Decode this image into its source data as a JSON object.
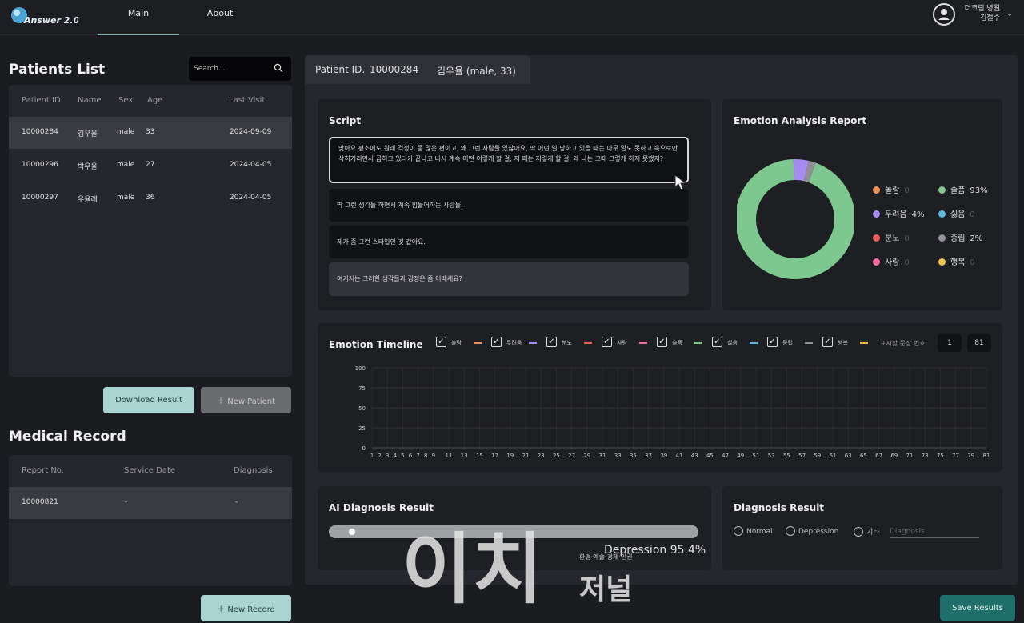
{
  "app": {
    "logo_text": "Answer 2.0"
  },
  "nav": {
    "main": "Main",
    "about": "About"
  },
  "user": {
    "line1": "더크림 병원",
    "line2": "김철수"
  },
  "patients": {
    "title": "Patients List",
    "search_placeholder": "Search...",
    "columns": [
      "Patient ID.",
      "Name",
      "Sex",
      "Age",
      "Last Visit"
    ],
    "rows": [
      {
        "id": "10000284",
        "name": "김우율",
        "sex": "male",
        "age": "33",
        "last": "2024-09-09"
      },
      {
        "id": "10000296",
        "name": "박우율",
        "sex": "male",
        "age": "27",
        "last": "2024-04-05"
      },
      {
        "id": "10000297",
        "name": "우율례",
        "sex": "male",
        "age": "36",
        "last": "2024-04-05"
      }
    ],
    "download": "Download Result",
    "new_patient": "New Patient"
  },
  "medical": {
    "title": "Medical Record",
    "columns": [
      "Report No.",
      "Service Date",
      "Diagnosis"
    ],
    "rows": [
      {
        "no": "10000821",
        "date": "-",
        "diag": "-"
      }
    ],
    "new_record": "New Record"
  },
  "tab": {
    "label": "Patient ID.",
    "id": "10000284",
    "name": "김우율 (male, 33)"
  },
  "script": {
    "title": "Script",
    "utterances": [
      "맞아요 평소에도 원래 걱정이 좀 많은 편이고, 왜 그런 사람들 있잖아요, 딱 어떤 일 당하고 있을 때는 아무 말도 못하고 속으로만 삭히거리면서 곱히고 있다가 끝나고 나서 계속 어떤 이렇게 할 걸, 저 때는 저렇게 할 걸, 왜 나는 그때 그렇게 하지 못했지?",
      "딱 그런 생각들 하면서 계속 힘들어하는 사람들.",
      "제가 좀 그런 스타일인 것 같아요.",
      "여기서는 그러한 생각들과 감정은 좀 어때세요?"
    ]
  },
  "emotion": {
    "title": "Emotion Analysis Report",
    "items": [
      {
        "label": "놀람",
        "pct": "0",
        "color": "#f0935a"
      },
      {
        "label": "슬픔",
        "pct": "93%",
        "color": "#7cc88f"
      },
      {
        "label": "두려움",
        "pct": "4%",
        "color": "#a68bf0"
      },
      {
        "label": "싫음",
        "pct": "0",
        "color": "#5cb8dc"
      },
      {
        "label": "분노",
        "pct": "0",
        "color": "#e8605a"
      },
      {
        "label": "중립",
        "pct": "2%",
        "color": "#909096"
      },
      {
        "label": "사랑",
        "pct": "0",
        "color": "#f06fa0"
      },
      {
        "label": "행복",
        "pct": "0",
        "color": "#f2c04e"
      }
    ]
  },
  "timeline": {
    "title": "Emotion Timeline",
    "legend": [
      {
        "label": "놀람",
        "color": "#f0935a"
      },
      {
        "label": "두려움",
        "color": "#a68bf0"
      },
      {
        "label": "분노",
        "color": "#e8605a"
      },
      {
        "label": "사랑",
        "color": "#f06fa0"
      },
      {
        "label": "슬픔",
        "color": "#7cc88f"
      },
      {
        "label": "싫음",
        "color": "#5cb8dc"
      },
      {
        "label": "중립",
        "color": "#909096"
      },
      {
        "label": "행복",
        "color": "#f2c04e"
      }
    ],
    "range_label": "표시할 문장 번호",
    "range_from": "1",
    "range_to": "81"
  },
  "chart_data": {
    "type": "line",
    "ylim": [
      0,
      100
    ],
    "yticks": [
      0,
      25,
      50,
      75,
      100
    ],
    "xticks": [
      1,
      2,
      3,
      4,
      5,
      6,
      7,
      8,
      9,
      11,
      13,
      15,
      17,
      19,
      21,
      23,
      25,
      27,
      29,
      31,
      33,
      35,
      37,
      39,
      41,
      43,
      45,
      47,
      49,
      51,
      53,
      55,
      57,
      59,
      61,
      63,
      65,
      67,
      69,
      71,
      73,
      75,
      77,
      79,
      81
    ],
    "x_range": [
      1,
      81
    ]
  },
  "ai": {
    "title": "AI Diagnosis Result",
    "result": "Depression 95.4%",
    "value": 0.954
  },
  "diagnosis": {
    "title": "Diagnosis Result",
    "options": [
      "Normal",
      "Depression",
      "기타"
    ],
    "input_placeholder": "Diagnosis"
  },
  "save": "Save Results",
  "watermark": {
    "main": "이치",
    "sub1": "환경·예술·경제·인권",
    "sub2": "저널"
  }
}
